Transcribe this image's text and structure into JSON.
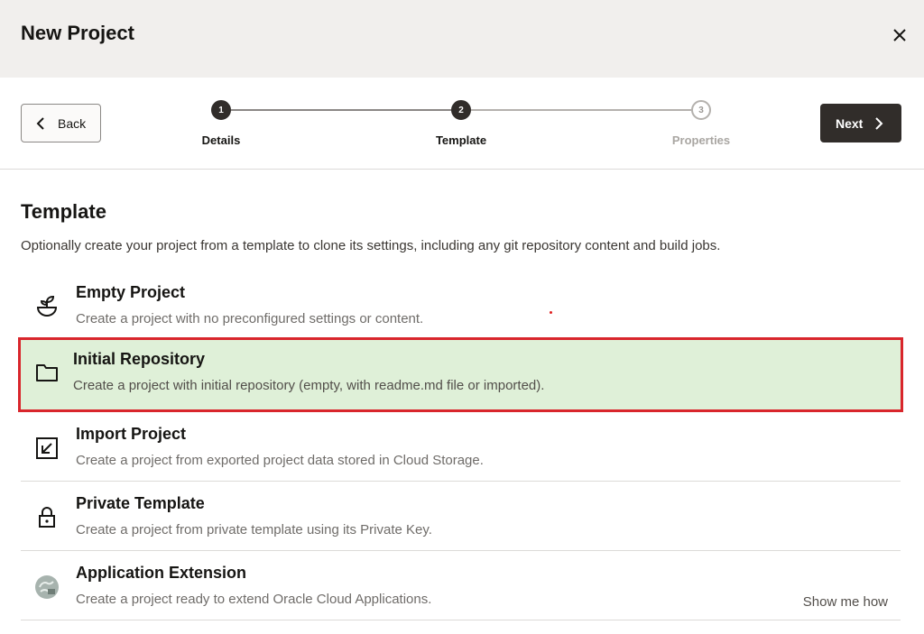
{
  "dialog": {
    "title": "New Project",
    "close_icon": "close-icon"
  },
  "nav": {
    "back_label": "Back",
    "next_label": "Next"
  },
  "steps": [
    {
      "number": "1",
      "label": "Details",
      "state": "done"
    },
    {
      "number": "2",
      "label": "Template",
      "state": "current"
    },
    {
      "number": "3",
      "label": "Properties",
      "state": "future"
    }
  ],
  "template": {
    "title": "Template",
    "description": "Optionally create your project from a template to clone its settings, including any git repository content and build jobs.",
    "options": [
      {
        "name": "Empty Project",
        "description": "Create a project with no preconfigured settings or content.",
        "icon": "plant-icon",
        "selected": false
      },
      {
        "name": "Initial Repository",
        "description": "Create a project with initial repository (empty, with readme.md file or imported).",
        "icon": "folder-icon",
        "selected": true
      },
      {
        "name": "Import Project",
        "description": "Create a project from exported project data stored in Cloud Storage.",
        "icon": "import-icon",
        "selected": false
      },
      {
        "name": "Private Template",
        "description": "Create a project from private template using its Private Key.",
        "icon": "lock-icon",
        "selected": false
      },
      {
        "name": "Application Extension",
        "description": "Create a project ready to extend Oracle Cloud Applications.",
        "icon": "extension-icon",
        "selected": false,
        "link": "Show me how"
      }
    ]
  },
  "colors": {
    "header_bg": "#f1efed",
    "primary_button": "#312d2a",
    "selected_bg": "#dff0d8",
    "selected_border": "#d9262c"
  }
}
